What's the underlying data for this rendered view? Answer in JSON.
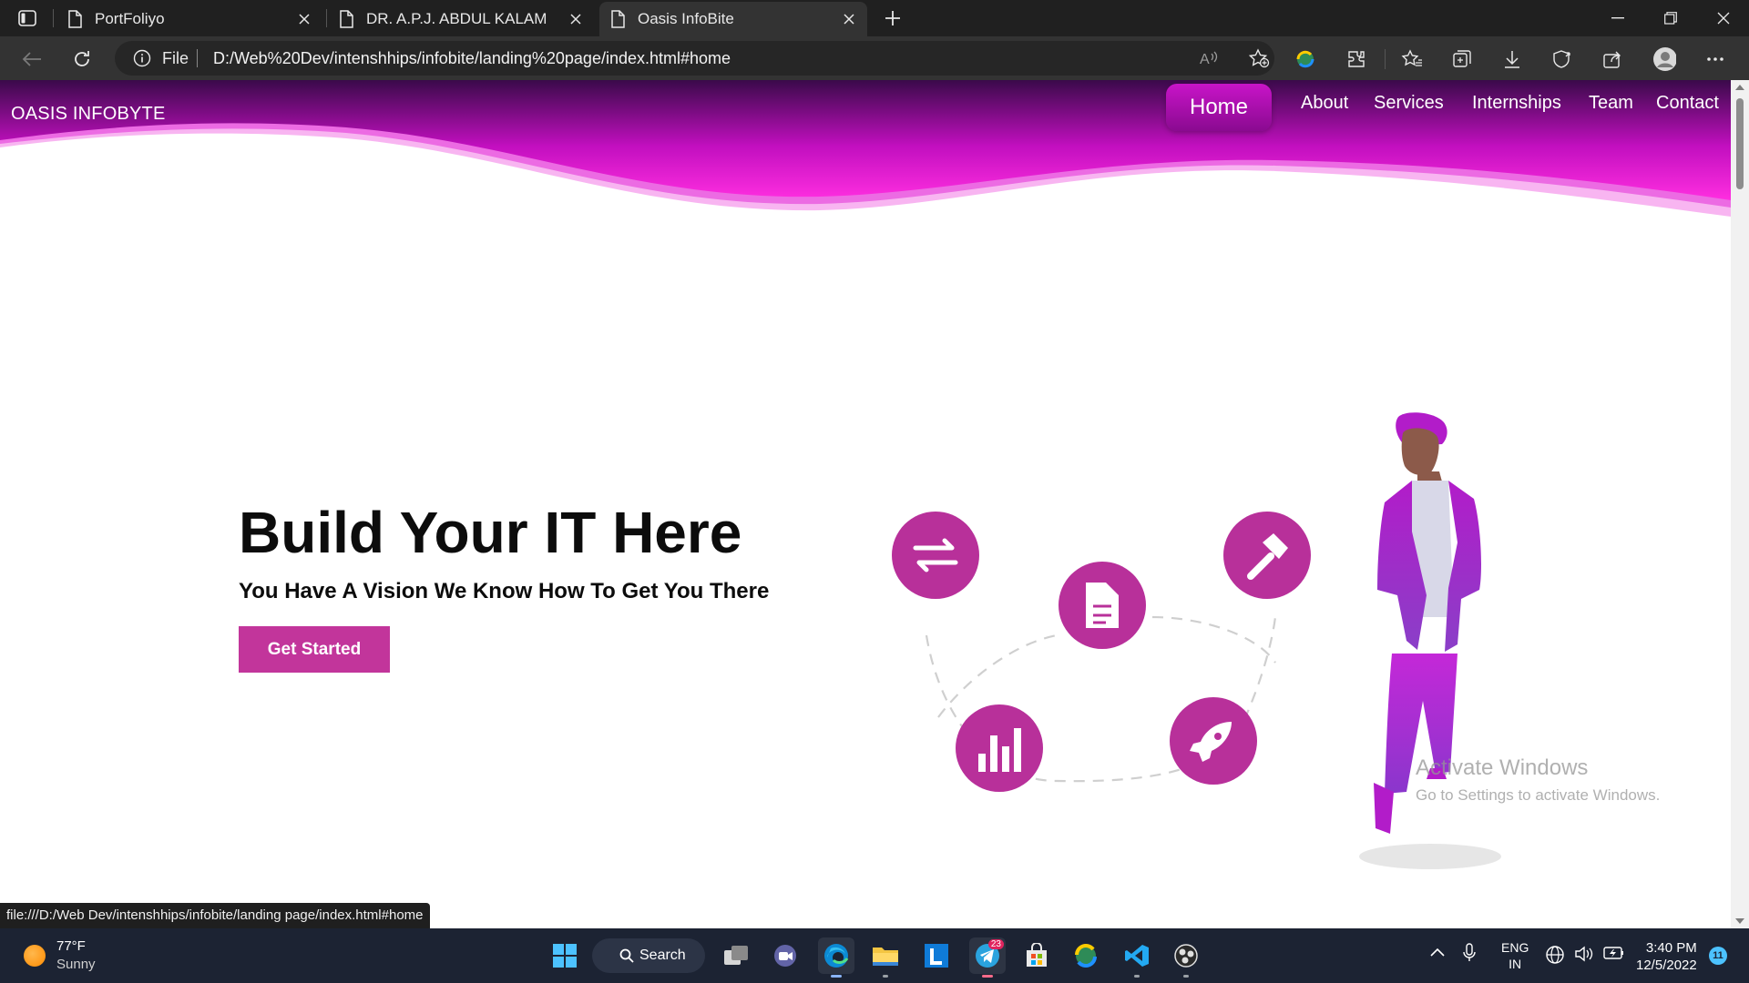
{
  "browser": {
    "tabs": [
      {
        "title": "PortFoliyo",
        "active": false
      },
      {
        "title": "DR. A.P.J. ABDUL KALAM",
        "active": false
      },
      {
        "title": "Oasis InfoBite",
        "active": true
      }
    ],
    "address": {
      "scheme_label": "File",
      "url": "D:/Web%20Dev/intenshhips/infobite/landing%20page/index.html#home"
    },
    "status_url": "file:///D:/Web Dev/intenshhips/infobite/landing page/index.html#home"
  },
  "site": {
    "brand": "OASIS INFOBYTE",
    "nav": [
      {
        "label": "Home",
        "active": true
      },
      {
        "label": "About",
        "active": false
      },
      {
        "label": "Services",
        "active": false
      },
      {
        "label": "Internships",
        "active": false
      },
      {
        "label": "Team",
        "active": false
      },
      {
        "label": "Contact",
        "active": false
      }
    ],
    "hero": {
      "title": "Build Your IT Here",
      "subtitle": "You Have A Vision We Know How To Get You There",
      "cta": "Get Started"
    },
    "illustration_icons": [
      "repeat-icon",
      "document-icon",
      "hammer-icon",
      "bar-chart-icon",
      "rocket-icon"
    ],
    "colors": {
      "accent": "#c2359b",
      "nav_gradient_top": "#3a0a4a",
      "nav_gradient_bottom": "#ff2ee0",
      "icon_circle": "#b8309a"
    }
  },
  "watermark": {
    "line1": "Activate Windows",
    "line2": "Go to Settings to activate Windows."
  },
  "taskbar": {
    "weather": {
      "temp": "77°F",
      "condition": "Sunny"
    },
    "search_label": "Search",
    "telegram_badge": "23",
    "language": {
      "line1": "ENG",
      "line2": "IN"
    },
    "clock": {
      "time": "3:40 PM",
      "date": "12/5/2022"
    },
    "notification_count": "11"
  }
}
